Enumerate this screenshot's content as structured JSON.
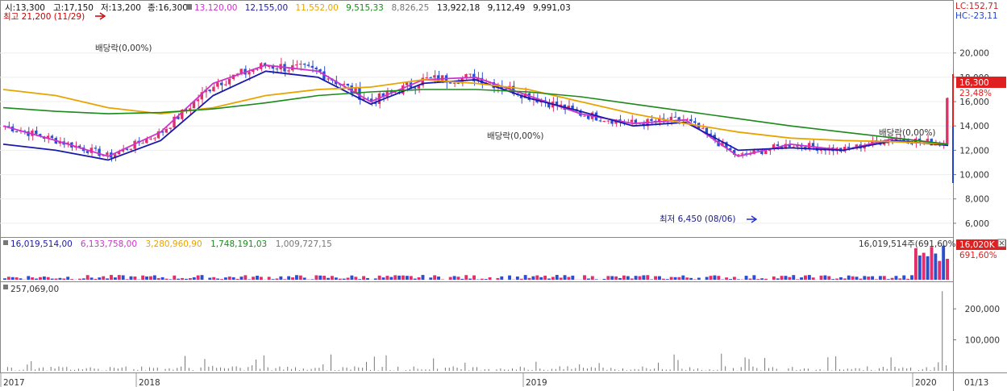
{
  "ohlc_info": {
    "open": "시:13,300",
    "high": "고:17,150",
    "low": "저:13,200",
    "close": "종:16,300"
  },
  "ma_values": [
    {
      "text": "13,120,00",
      "color": "#cc33cc"
    },
    {
      "text": "12,155,00",
      "color": "#1a1aaa"
    },
    {
      "text": "11,552,00",
      "color": "#e8a400"
    },
    {
      "text": "9,515,33",
      "color": "#1a8a1a"
    },
    {
      "text": "8,826,25",
      "color": "#777777"
    },
    {
      "text": "13,922,18",
      "color": "#111111"
    },
    {
      "text": "9,112,49",
      "color": "#111111"
    },
    {
      "text": "9,991,03",
      "color": "#111111"
    }
  ],
  "corner": {
    "lc": "LC:152,71",
    "hc": "HC:-23,11"
  },
  "annotations": {
    "high_label": "최고 21,200 (11/29)",
    "low_label": "최저 6,450 (08/06)",
    "dividend_1": "배당락(0,00%)",
    "dividend_2": "배당락(0,00%)",
    "dividend_3": "배당락(0,00%)"
  },
  "price_badge": {
    "value": "16,300",
    "pct": "23,48%"
  },
  "volume_panel": {
    "legend": [
      {
        "text": "16,019,514,00",
        "color": "#1a1aaa"
      },
      {
        "text": "6,133,758,00",
        "color": "#cc33cc"
      },
      {
        "text": "3,280,960,90",
        "color": "#e8a400"
      },
      {
        "text": "1,748,191,03",
        "color": "#1a8a1a"
      },
      {
        "text": "1,009,727,15",
        "color": "#777777"
      }
    ],
    "summary": "16,019,514주(691,60%)",
    "badge_value": "16,020K",
    "badge_pct": "691,60%"
  },
  "lower_panel": {
    "legend": "257,069,00"
  },
  "x_axis": {
    "labels": [
      "2017",
      "2018",
      "2019",
      "2020"
    ],
    "right_label": "01/13"
  },
  "chart_data": [
    {
      "type": "line",
      "title": "",
      "y_axis_ticks": [
        6000,
        8000,
        10000,
        12000,
        14000,
        16000,
        18000,
        20000
      ],
      "ylim": [
        5000,
        22500
      ],
      "x": [
        "2017-01",
        "2017-03",
        "2017-05",
        "2017-07",
        "2017-09",
        "2017-11",
        "2018-01",
        "2018-03",
        "2018-05",
        "2018-07",
        "2018-09",
        "2018-11",
        "2019-01",
        "2019-03",
        "2019-05",
        "2019-07",
        "2019-09",
        "2019-11",
        "2020-01"
      ],
      "series": [
        {
          "values": [
            14000,
            12800,
            11500,
            13500,
            17500,
            19000,
            18500,
            16000,
            17800,
            18000,
            16500,
            15000,
            14200,
            14500,
            11500,
            12500,
            12000,
            13000,
            12500
          ]
        },
        {
          "values": [
            12500,
            12000,
            11200,
            12800,
            16500,
            18500,
            18000,
            15800,
            17500,
            17800,
            16300,
            15200,
            14000,
            14300,
            12000,
            12200,
            12000,
            12800,
            12400
          ]
        },
        {
          "values": [
            17000,
            16500,
            15500,
            15000,
            15500,
            16500,
            17000,
            17200,
            17800,
            17500,
            17000,
            16000,
            15000,
            14200,
            13500,
            13000,
            12800,
            12700,
            12500
          ]
        },
        {
          "values": [
            15500,
            15200,
            15000,
            15100,
            15400,
            15900,
            16500,
            16800,
            17000,
            17000,
            16800,
            16400,
            15800,
            15200,
            14600,
            14000,
            13500,
            13000,
            12500
          ]
        }
      ]
    },
    {
      "type": "bar",
      "title": "",
      "legend_value": "16,019,514,00"
    },
    {
      "type": "bar",
      "title": "",
      "y_axis_ticks": [
        100000,
        200000
      ],
      "legend_value": "257,069,00"
    }
  ]
}
